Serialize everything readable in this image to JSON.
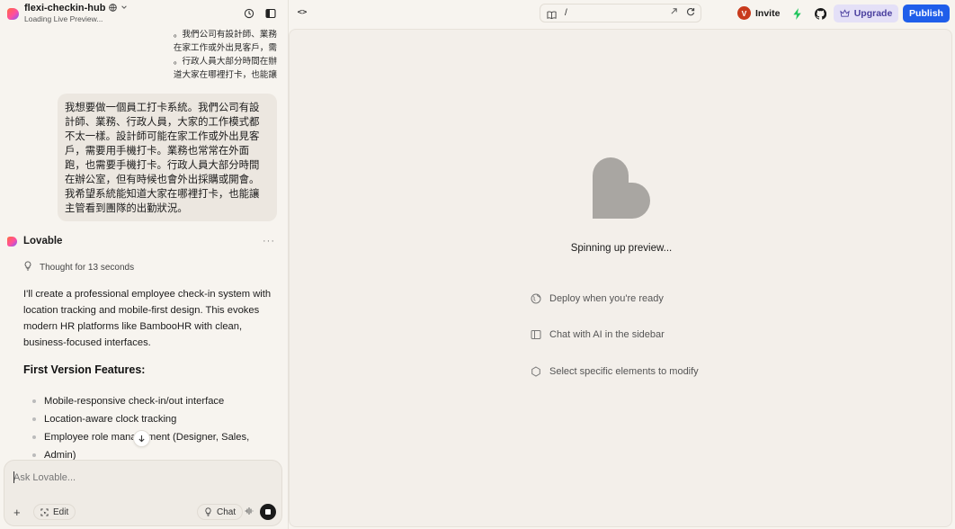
{
  "header": {
    "project_name": "flexi-checkin-hub",
    "project_status": "Loading Live Preview...",
    "globe_icon": "globe-icon",
    "chevron_icon": "chevron-down-icon"
  },
  "chat": {
    "previous_message_lines": [
      "。我們公司有設計師、業務",
      "在家工作或外出見客戶，需",
      "。行政人員大部分時間在辦",
      "道大家在哪裡打卡，也能讓"
    ],
    "user_message_lines": [
      "我想要做一個員工打卡系統。我們公司有設",
      "計師、業務、行政人員，大家的工作模式都",
      "不太一樣。設計師可能在家工作或外出見客",
      "戶，需要用手機打卡。業務也常常在外面",
      "跑，也需要手機打卡。行政人員大部分時間",
      "在辦公室，但有時候也會外出採購或開會。",
      "我希望系統能知道大家在哪裡打卡，也能讓",
      "主管看到團隊的出勤狀況。"
    ],
    "assistant_name": "Lovable",
    "more_label": "···",
    "thought_label": "Thought for 13 seconds",
    "response_lines": [
      "I'll create a professional employee check-in system with",
      "location tracking and mobile-first design. This evokes",
      "modern HR platforms like BambooHR with clean,",
      "business-focused interfaces."
    ],
    "features_title": "First Version Features:",
    "features": [
      "Mobile-responsive check-in/out interface",
      "Location-aware clock tracking",
      "Employee role management (Designer, Sales,",
      "Admin)"
    ]
  },
  "composer": {
    "placeholder": "Ask Lovable...",
    "plus_label": "+",
    "edit_label": "Edit",
    "chat_label": "Chat"
  },
  "toolbar": {
    "code_label": "<>",
    "url_path": "/",
    "avatar_letter": "V",
    "invite_label": "Invite",
    "upgrade_label": "Upgrade",
    "publish_label": "Publish"
  },
  "preview": {
    "status": "Spinning up preview...",
    "tips": [
      "Deploy when you're ready",
      "Chat with AI in the sidebar",
      "Select specific elements to modify"
    ]
  },
  "colors": {
    "background": "#f7f4ef",
    "preview_bg": "#f3efea",
    "publish": "#1f5eea",
    "upgrade_bg": "#e4e0f7",
    "avatar": "#c83a1c",
    "bolt": "#22c55e",
    "heart": "#a9a6a2"
  }
}
